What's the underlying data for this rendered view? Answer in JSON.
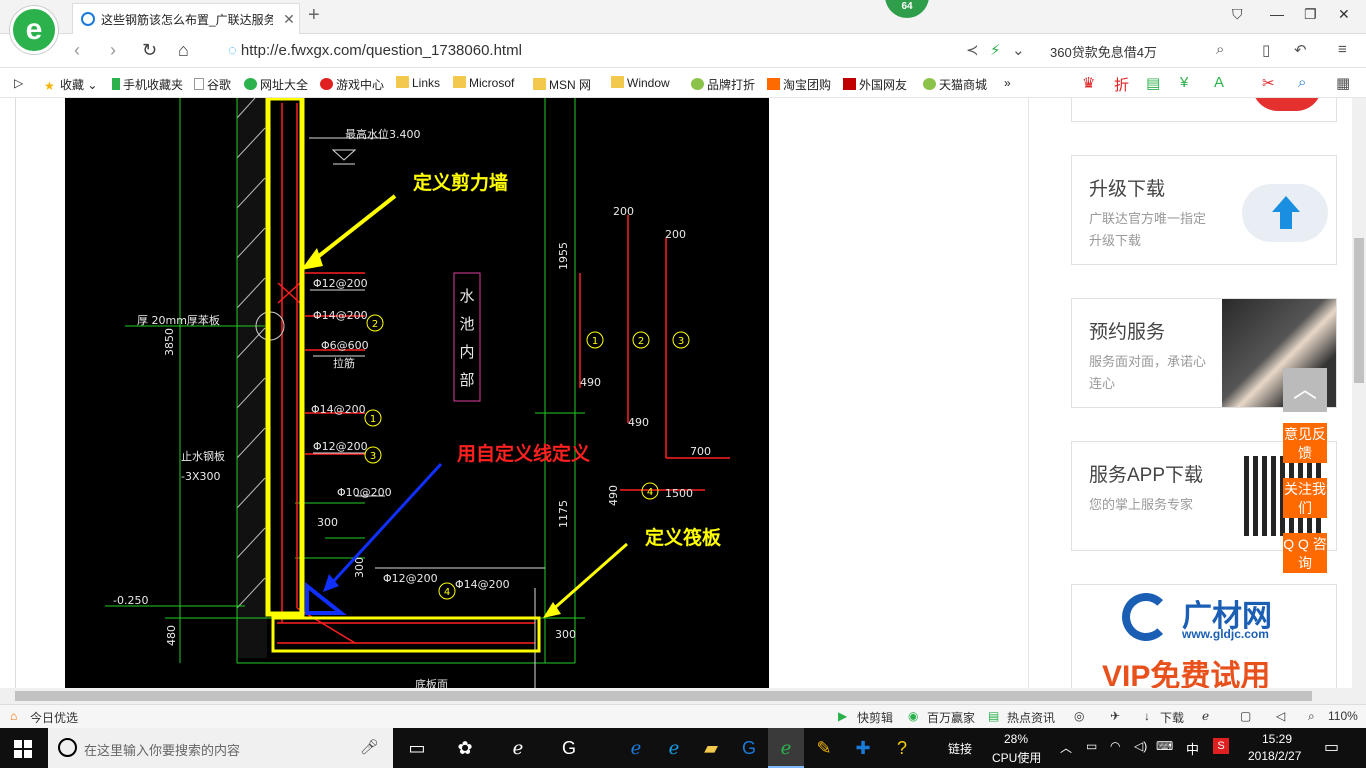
{
  "browser": {
    "logo_letter": "e",
    "tab_title": "这些钢筋该怎么布置_广联达服务",
    "badge": "64",
    "url": "http://e.fwxgx.com/question_1738060.html",
    "search_text": "360贷款免息借4万"
  },
  "bookmarks": [
    "收藏",
    "手机收藏夹",
    "谷歌",
    "网址大全",
    "游戏中心",
    "Links",
    "Microsof",
    "MSN 网",
    "Window",
    "品牌打折",
    "淘宝团购",
    "外国网友",
    "天猫商城"
  ],
  "drawing": {
    "annotations": {
      "shear_wall": "定义剪力墙",
      "custom_line": "用自定义线定义",
      "raft": "定义筏板"
    },
    "labels": {
      "water_level": "最高水位3.400",
      "pool_text": [
        "水",
        "池",
        "内",
        "部"
      ],
      "r1": "Φ12@200",
      "r2": "Φ14@200",
      "r3": "Φ6@600",
      "r3b": "拉筋",
      "r4": "Φ14@200",
      "r5": "Φ12@200",
      "r6": "Φ10@200",
      "r7": "Φ12@200",
      "r8": "Φ14@200",
      "board": "厚 20mm厚苯板",
      "stop_plate": "止水钢板",
      "stop_size": "-3X300",
      "elev": "-0.250",
      "d3850": "3850",
      "d1955": "1955",
      "d1175": "1175",
      "d480": "480",
      "d300": "300",
      "d300b": "300",
      "d300c": "300",
      "d200a": "200",
      "d200b": "200",
      "d490a": "490",
      "d490b": "490",
      "d490c": "490",
      "d700": "700",
      "d1500": "1500",
      "c1": "1",
      "c2": "2",
      "c3": "3",
      "c4": "4",
      "bottom": "底板面"
    }
  },
  "sidebar": {
    "cards": [
      {
        "title": "升级下载",
        "sub": "广联达官方唯一指定升级下载"
      },
      {
        "title": "预约服务",
        "sub": "服务面对面，承诺心连心"
      },
      {
        "title": "服务APP下载",
        "sub": "您的掌上服务专家"
      }
    ],
    "ad_logo": "广材网",
    "ad_url": "www.gldjc.com",
    "ad_vip": "VIP免费试用",
    "buttons": [
      "意见反馈",
      "关注我们",
      "Q Q 咨询"
    ]
  },
  "statusbar": {
    "left": "今日优选",
    "items": [
      "快剪辑",
      "百万赢家",
      "热点资讯",
      "下载"
    ],
    "zoom": "110%"
  },
  "taskbar": {
    "search_placeholder": "在这里输入你要搜索的内容",
    "link": "链接",
    "cpu_pct": "28%",
    "cpu_label": "CPU使用",
    "ime": "中",
    "time": "15:29",
    "date": "2018/2/27"
  },
  "colors": {
    "accent": "#2bb24c",
    "orange": "#ff6a00",
    "cad_yellow": "#ffff00",
    "cad_red": "#ff2020",
    "cad_blue": "#1030ff"
  }
}
